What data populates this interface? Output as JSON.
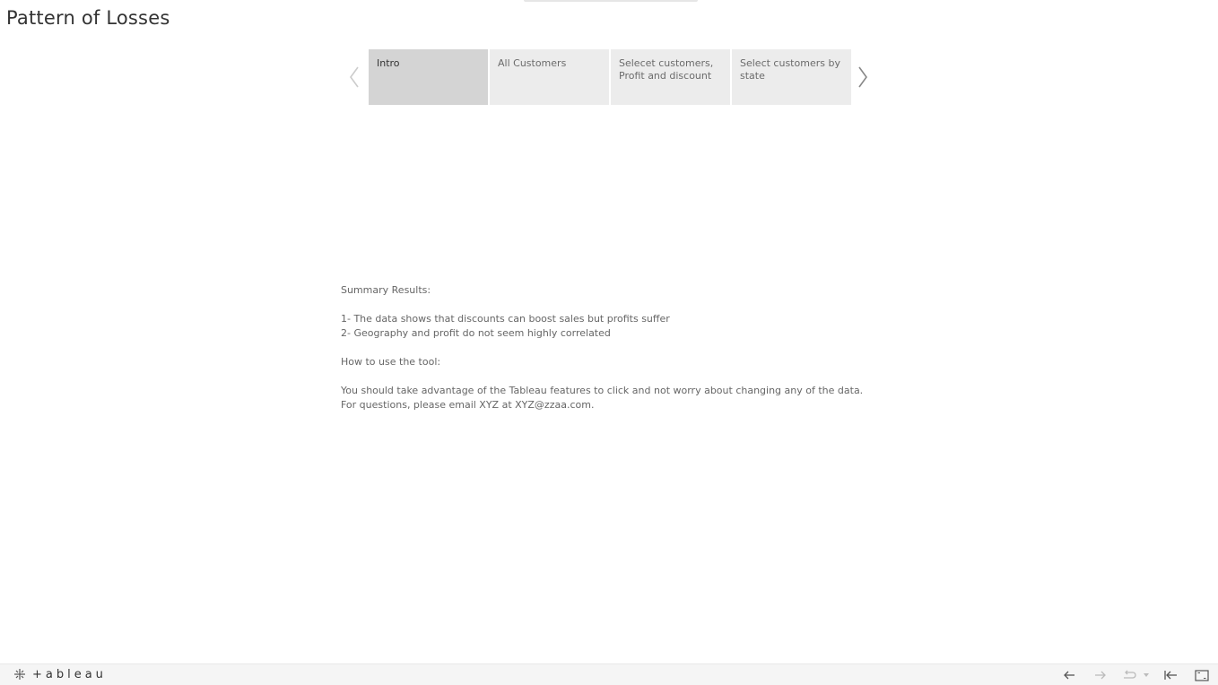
{
  "story": {
    "title": "Pattern of Losses",
    "story_points": [
      {
        "label": "Intro",
        "active": true
      },
      {
        "label": "All Customers",
        "active": false
      },
      {
        "label": "Selecet customers, Profit and discount",
        "active": false
      },
      {
        "label": "Select customers by state",
        "active": false
      }
    ]
  },
  "summary": {
    "heading": "Summary Results:",
    "point_1": "1- The data shows that discounts can boost sales but profits suffer",
    "point_2": "2- Geography and profit do not seem highly correlated",
    "howto_heading": "How to use the tool:",
    "howto_line_1": "You should take advantage of the Tableau features to click and not worry about changing any of the data.",
    "howto_line_2": "For questions, please email XYZ at XYZ@zzaa.com."
  },
  "toolbar": {
    "brand": "+ableau",
    "icons": [
      "tableau-logo-icon",
      "undo-icon",
      "redo-icon",
      "revert-icon",
      "dropdown-icon",
      "revert-all-icon",
      "fullscreen-icon"
    ]
  },
  "colors": {
    "active_tab": "#d4d4d4",
    "inactive_tab": "#ececec",
    "toolbar_bg": "#f5f5f5"
  }
}
